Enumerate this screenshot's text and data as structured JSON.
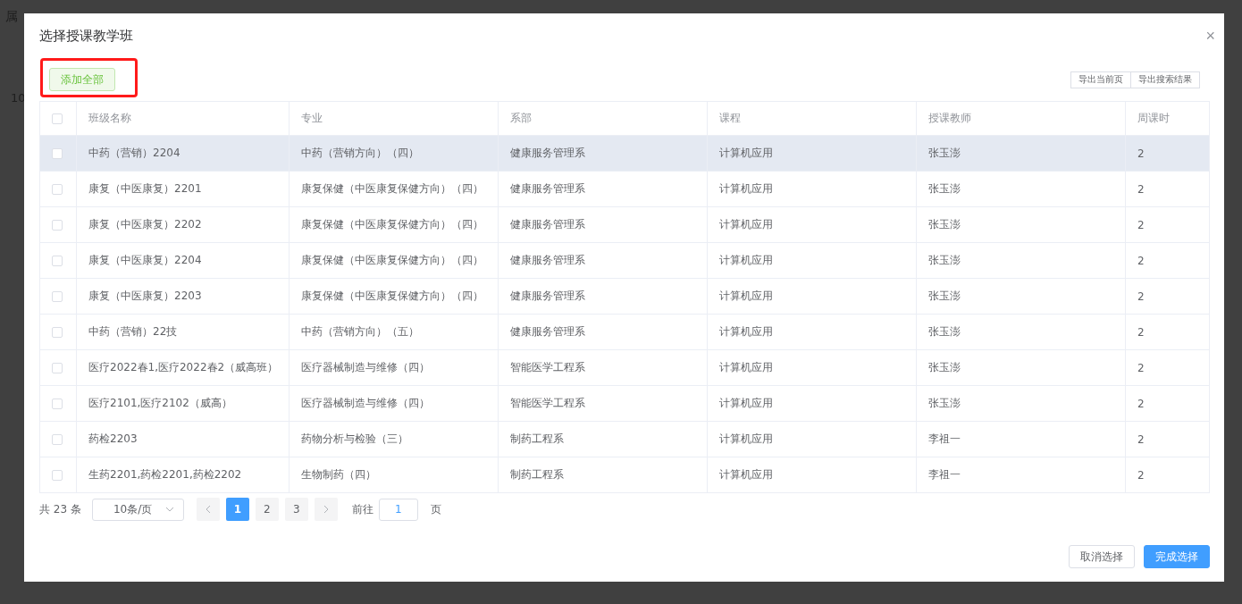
{
  "background": {
    "header_text": "属",
    "cell_text": "10"
  },
  "dialog": {
    "title": "选择授课教学班",
    "close": "×",
    "add_all_button": {
      "label": "添加全部",
      "annotated": true
    },
    "export_buttons": [
      "导出当前页",
      "导出搜索结果"
    ],
    "table": {
      "header_checked": false,
      "columns": [
        "班级名称",
        "专业",
        "系部",
        "课程",
        "授课教师",
        "周课时"
      ],
      "rows": [
        {
          "checked": false,
          "highlighted": true,
          "cells": [
            "中药（营销）2204",
            "中药（营销方向）（四）",
            "健康服务管理系",
            "计算机应用",
            "张玉澎",
            "2"
          ]
        },
        {
          "checked": false,
          "highlighted": false,
          "cells": [
            "康复（中医康复）2201",
            "康复保健（中医康复保健方向）（四）",
            "健康服务管理系",
            "计算机应用",
            "张玉澎",
            "2"
          ]
        },
        {
          "checked": false,
          "highlighted": false,
          "cells": [
            "康复（中医康复）2202",
            "康复保健（中医康复保健方向）（四）",
            "健康服务管理系",
            "计算机应用",
            "张玉澎",
            "2"
          ]
        },
        {
          "checked": false,
          "highlighted": false,
          "cells": [
            "康复（中医康复）2204",
            "康复保健（中医康复保健方向）（四）",
            "健康服务管理系",
            "计算机应用",
            "张玉澎",
            "2"
          ]
        },
        {
          "checked": false,
          "highlighted": false,
          "cells": [
            "康复（中医康复）2203",
            "康复保健（中医康复保健方向）（四）",
            "健康服务管理系",
            "计算机应用",
            "张玉澎",
            "2"
          ]
        },
        {
          "checked": false,
          "highlighted": false,
          "cells": [
            "中药（营销）22技",
            "中药（营销方向）（五）",
            "健康服务管理系",
            "计算机应用",
            "张玉澎",
            "2"
          ]
        },
        {
          "checked": false,
          "highlighted": false,
          "cells": [
            "医疗2022春1,医疗2022春2（威高班）",
            "医疗器械制造与维修（四）",
            "智能医学工程系",
            "计算机应用",
            "张玉澎",
            "2"
          ]
        },
        {
          "checked": false,
          "highlighted": false,
          "cells": [
            "医疗2101,医疗2102（威高）",
            "医疗器械制造与维修（四）",
            "智能医学工程系",
            "计算机应用",
            "张玉澎",
            "2"
          ]
        },
        {
          "checked": false,
          "highlighted": false,
          "cells": [
            "药检2203",
            "药物分析与检验（三）",
            "制药工程系",
            "计算机应用",
            "李祖一",
            "2"
          ]
        },
        {
          "checked": false,
          "highlighted": false,
          "cells": [
            "生药2201,药检2201,药检2202",
            "生物制药（四）",
            "制药工程系",
            "计算机应用",
            "李祖一",
            "2"
          ]
        }
      ]
    },
    "pagination": {
      "total": "共 23 条",
      "page_size": "10条/页",
      "pages": [
        {
          "label": "1",
          "selected": true
        },
        {
          "label": "2",
          "selected": false
        },
        {
          "label": "3",
          "selected": false
        }
      ],
      "goto_label": "前往",
      "goto_value": "1",
      "goto_suffix": "页"
    },
    "footer_buttons": [
      {
        "label": "取消选择",
        "kind": "secondary"
      },
      {
        "label": "完成选择",
        "kind": "primary"
      }
    ]
  }
}
